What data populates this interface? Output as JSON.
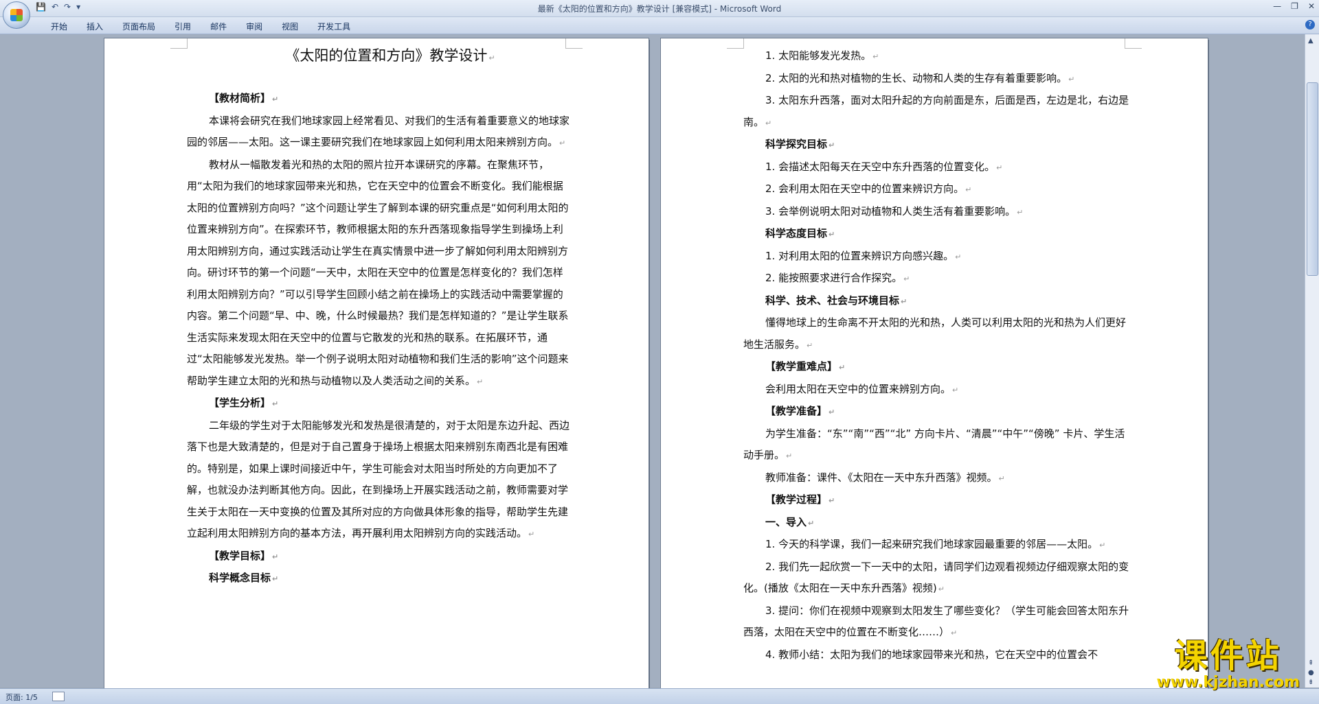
{
  "window": {
    "title": "最新《太阳的位置和方向》教学设计 [兼容模式] - Microsoft Word"
  },
  "qat": {
    "save_icon": "save-icon",
    "undo_icon": "undo-icon",
    "redo_icon": "redo-icon",
    "customize": "▾"
  },
  "ribbon": {
    "tabs": [
      "开始",
      "插入",
      "页面布局",
      "引用",
      "邮件",
      "审阅",
      "视图",
      "开发工具"
    ]
  },
  "page1": {
    "title": "《太阳的位置和方向》教学设计",
    "h_material": "【教材简析】",
    "p1": "本课将会研究在我们地球家园上经常看见、对我们的生活有着重要意义的地球家园的邻居——太阳。这一课主要研究我们在地球家园上如何利用太阳来辨别方向。",
    "p2": "教材从一幅散发着光和热的太阳的照片拉开本课研究的序幕。在聚焦环节，用“太阳为我们的地球家园带来光和热，它在天空中的位置会不断变化。我们能根据太阳的位置辨别方向吗？”这个问题让学生了解到本课的研究重点是“如何利用太阳的位置来辨别方向”。在探索环节，教师根据太阳的东升西落现象指导学生到操场上利用太阳辨别方向，通过实践活动让学生在真实情景中进一步了解如何利用太阳辨别方向。研讨环节的第一个问题“一天中，太阳在天空中的位置是怎样变化的？我们怎样利用太阳辨别方向？”可以引导学生回顾小结之前在操场上的实践活动中需要掌握的内容。第二个问题“早、中、晚，什么时候最热？我们是怎样知道的？”是让学生联系生活实际来发现太阳在天空中的位置与它散发的光和热的联系。在拓展环节，通过“太阳能够发光发热。举一个例子说明太阳对动植物和我们生活的影响”这个问题来帮助学生建立太阳的光和热与动植物以及人类活动之间的关系。",
    "h_students": "【学生分析】",
    "p3": "二年级的学生对于太阳能够发光和发热是很清楚的，对于太阳是东边升起、西边落下也是大致清楚的，但是对于自己置身于操场上根据太阳来辨别东南西北是有困难的。特别是，如果上课时间接近中午，学生可能会对太阳当时所处的方向更加不了解，也就没办法判断其他方向。因此，在到操场上开展实践活动之前，教师需要对学生关于太阳在一天中变换的位置及其所对应的方向做具体形象的指导，帮助学生先建立起利用太阳辨别方向的基本方法，再开展利用太阳辨别方向的实践活动。",
    "h_goals": "【教学目标】",
    "h_concept": "科学概念目标"
  },
  "page2": {
    "c1": "1. 太阳能够发光发热。",
    "c2": "2. 太阳的光和热对植物的生长、动物和人类的生存有着重要影响。",
    "c3": "3. 太阳东升西落，面对太阳升起的方向前面是东，后面是西，左边是北，右边是南。",
    "h_inquiry": "科学探究目标",
    "i1": "1. 会描述太阳每天在天空中东升西落的位置变化。",
    "i2": "2. 会利用太阳在天空中的位置来辨识方向。",
    "i3": "3. 会举例说明太阳对动植物和人类生活有着重要影响。",
    "h_attitude": "科学态度目标",
    "a1": "1. 对利用太阳的位置来辨识方向感兴趣。",
    "a2": "2. 能按照要求进行合作探究。",
    "h_sts": "科学、技术、社会与环境目标",
    "s1": "懂得地球上的生命离不开太阳的光和热，人类可以利用太阳的光和热为人们更好地生活服务。",
    "h_key": "【教学重难点】",
    "k1": "会利用太阳在天空中的位置来辨别方向。",
    "h_prep": "【教学准备】",
    "pr1": "为学生准备：“东”“南”“西”“北” 方向卡片、“清晨”“中午”“傍晚” 卡片、学生活动手册。",
    "pr2": "教师准备：课件、《太阳在一天中东升西落》视频。",
    "h_process": "【教学过程】",
    "h_intro": "一、导入",
    "n1": "1. 今天的科学课，我们一起来研究我们地球家园最重要的邻居——太阳。",
    "n2": "2. 我们先一起欣赏一下一天中的太阳，请同学们边观看视频边仔细观察太阳的变化。(播放《太阳在一天中东升西落》视频)",
    "n3": "3. 提问：你们在视频中观察到太阳发生了哪些变化？（学生可能会回答太阳东升西落，太阳在天空中的位置在不断变化……）",
    "n4": "4. 教师小结：太阳为我们的地球家园带来光和热，它在天空中的位置会不"
  },
  "status": {
    "page": "页面: 1/5"
  },
  "watermark": {
    "text": "课件站",
    "url": "www.kjzhan.com"
  }
}
